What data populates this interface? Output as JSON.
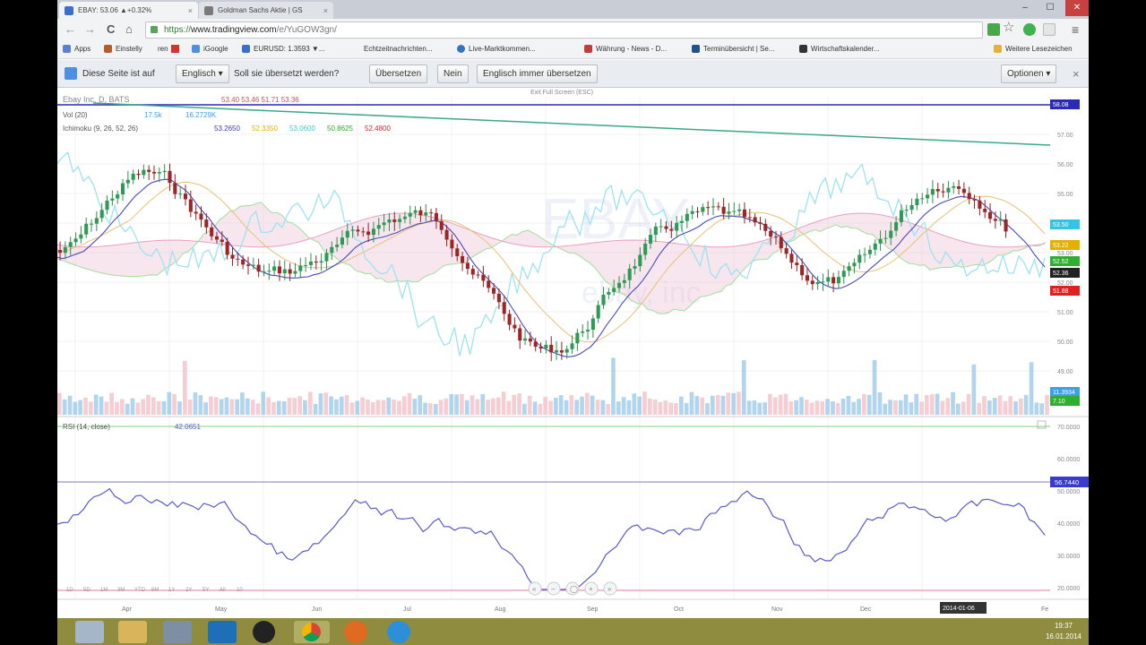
{
  "browser": {
    "tabs": [
      {
        "title": "EBAY: 53.06 ▲+0.32%",
        "close": "×"
      },
      {
        "title": "Goldman Sachs Aktie | GS",
        "close": "×"
      }
    ],
    "address_scheme": "https://",
    "address_host": "www.tradingview.com",
    "address_path": "/e/YuGOW3gn/",
    "controls": {
      "back": "←",
      "forward": "→",
      "reload": "C",
      "home": "⌂",
      "star": "☆",
      "menu": "≡",
      "minimize": "–",
      "maximize": "☐",
      "close": "✕"
    }
  },
  "bookmarks": {
    "items": [
      "Apps",
      "Einstelly",
      "ren",
      "iGoogle",
      "EURUSD: 1.3593 ▼...",
      "Echtzeitnachrichten...",
      "Live-Marktkommen...",
      "Währung - News - D...",
      "Terminübersicht | Se...",
      "Wirtschaftskalender..."
    ],
    "other": "Weitere Lesezeichen"
  },
  "translate": {
    "prefix": "Diese Seite ist auf",
    "language": "Englisch ▾",
    "question": "Soll sie übersetzt werden?",
    "translate_btn": "Übersetzen",
    "no_btn": "Nein",
    "always_btn": "Englisch immer übersetzen",
    "options_btn": "Optionen ▾",
    "close": "×"
  },
  "chart": {
    "symbol_line": "Ebay Inc, D, BATS",
    "ohlc": "53.40 53.46 51.71 53.36",
    "vol_label": "Vol (20)",
    "vol_values": "17.5k",
    "vol_values2": "16.2729K",
    "ichimoku_label": "Ichimoku (9, 26, 52, 26)",
    "ichimoku_values": [
      "53.2650",
      "52.3350",
      "53.0600",
      "50.8625",
      "52.4800"
    ],
    "ichimoku_colors": [
      "#3b3bb8",
      "#e4b000",
      "#40c8e0",
      "#2fae2f",
      "#d02a2a"
    ],
    "rsi_label": "RSI (14, close)",
    "rsi_value": "42.0651",
    "fullscreen_hint": "Exit Full Screen (ESC)",
    "watermark": "EBAY",
    "watermark_sub": "ebay, inc",
    "price_ticks": [
      "57.00",
      "56.00",
      "55.00",
      "54.00",
      "53.00",
      "52.00",
      "51.00",
      "50.00",
      "49.00"
    ],
    "price_tags": [
      {
        "text": "58.08",
        "color": "#2a2ab8"
      },
      {
        "text": "53.50",
        "color": "#31c4e4"
      },
      {
        "text": "53.22",
        "color": "#e4b000"
      },
      {
        "text": "52.52",
        "color": "#2fae2f"
      },
      {
        "text": "52.36",
        "color": "#222222"
      },
      {
        "text": "51.88",
        "color": "#e02020"
      },
      {
        "text": "11.3934",
        "color": "#3aa0e8"
      },
      {
        "text": "7.10",
        "color": "#2fae2f"
      }
    ],
    "rsi_ticks": [
      "70.0000",
      "60.0000",
      "50.0000",
      "40.0000",
      "30.0000",
      "20.0000"
    ],
    "rsi_tag": "56.7440",
    "months": [
      "Apr",
      "May",
      "Jun",
      "Jul",
      "Aug",
      "Sep",
      "Oct",
      "Nov",
      "Dec",
      "Fe"
    ],
    "date_tag": "2014-01-06",
    "period_buttons": [
      "1D",
      "5D",
      "1M",
      "3M",
      "YTD",
      "6M",
      "1Y",
      "2Y",
      "5Y",
      "All",
      "10"
    ],
    "nav_buttons": [
      "«",
      "–",
      "◯",
      "+",
      "»"
    ]
  },
  "taskbar": {
    "time": "19:37",
    "date": "16.01.2014",
    "accent": "#8f8c3f",
    "icons": [
      "start-icon",
      "explorer-icon",
      "libraries-icon",
      "app-icon",
      "xbmc-icon",
      "chrome-icon",
      "firefox-icon",
      "other-icon"
    ]
  }
}
